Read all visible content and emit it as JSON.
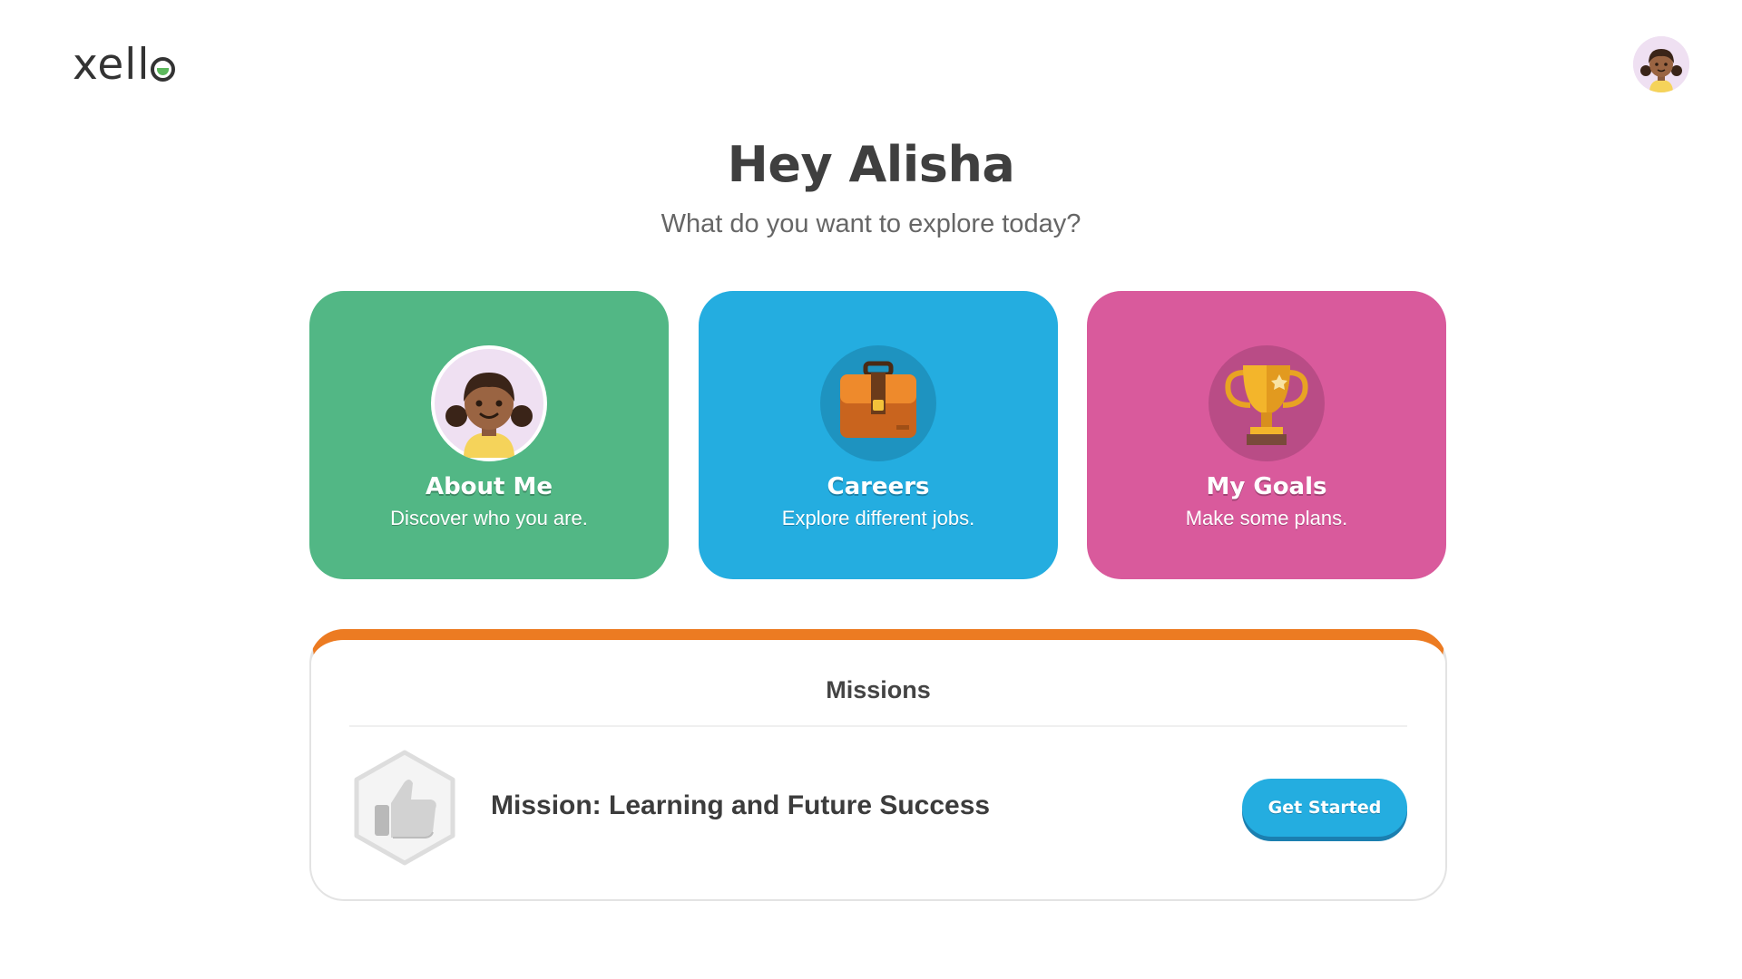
{
  "header": {
    "logo_text": "xell",
    "logo_full": "xello",
    "avatar_icon": "user-avatar-girl",
    "accent_color": "#5cb85c"
  },
  "greeting": {
    "title": "Hey Alisha",
    "subtitle": "What do you want to explore today?"
  },
  "cards": [
    {
      "title": "About Me",
      "description": "Discover who you are.",
      "icon": "girl-avatar-icon",
      "color": "#52b785"
    },
    {
      "title": "Careers",
      "description": "Explore different jobs.",
      "icon": "briefcase-icon",
      "color": "#24ade0"
    },
    {
      "title": "My Goals",
      "description": "Make some plans.",
      "icon": "trophy-icon",
      "color": "#d95a9c"
    }
  ],
  "missions": {
    "title": "Missions",
    "accent_color": "#ec7b22",
    "items": [
      {
        "name": "Mission: Learning and Future Success",
        "icon": "thumbs-up-badge-icon",
        "button_label": "Get Started"
      }
    ]
  }
}
